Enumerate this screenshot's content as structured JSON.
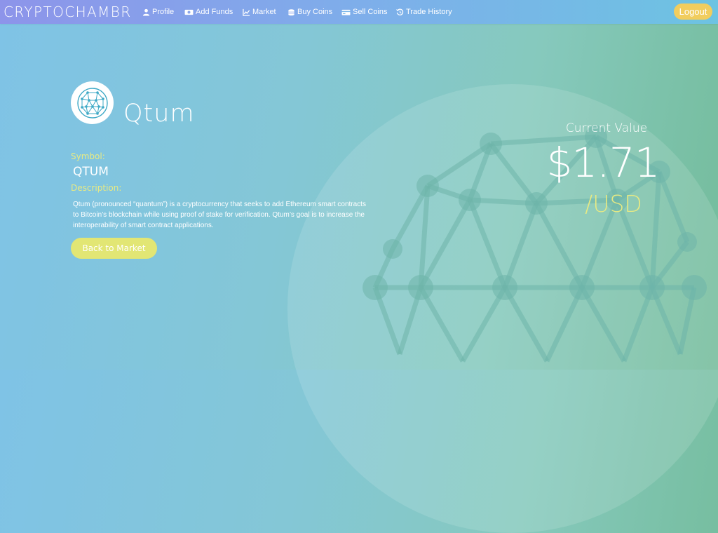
{
  "brand": "CRYPTOCHAMBR",
  "nav": {
    "items": [
      {
        "label": "Profile",
        "icon": "user-icon"
      },
      {
        "label": "Add Funds",
        "icon": "money-icon"
      },
      {
        "label": "Market",
        "icon": "chart-icon"
      },
      {
        "label": "Buy Coins",
        "icon": "coins-icon"
      },
      {
        "label": "Sell Coins",
        "icon": "card-icon"
      },
      {
        "label": "Trade History",
        "icon": "history-icon"
      }
    ],
    "logout_label": "Logout"
  },
  "coin": {
    "name": "Qtum",
    "symbol_label": "Symbol:",
    "symbol": "QTUM",
    "description_label": "Description:",
    "description": "Qtum (pronounced “quantum”) is a cryptocurrency that seeks to add Ethereum smart contracts to Bitcoin’s blockchain while using proof of stake for verification. Qtum’s goal is to increase the interoperability of smart contract applications.",
    "back_label": "Back to Market",
    "logo_icon": "qtum-logo-icon"
  },
  "price": {
    "label": "Current Value",
    "value": "$1.71",
    "unit": "/USD"
  },
  "colors": {
    "accent_yellow": "#e8ea83",
    "button_yellow": "#e2e674",
    "logout_yellow": "#f1cd5e"
  }
}
